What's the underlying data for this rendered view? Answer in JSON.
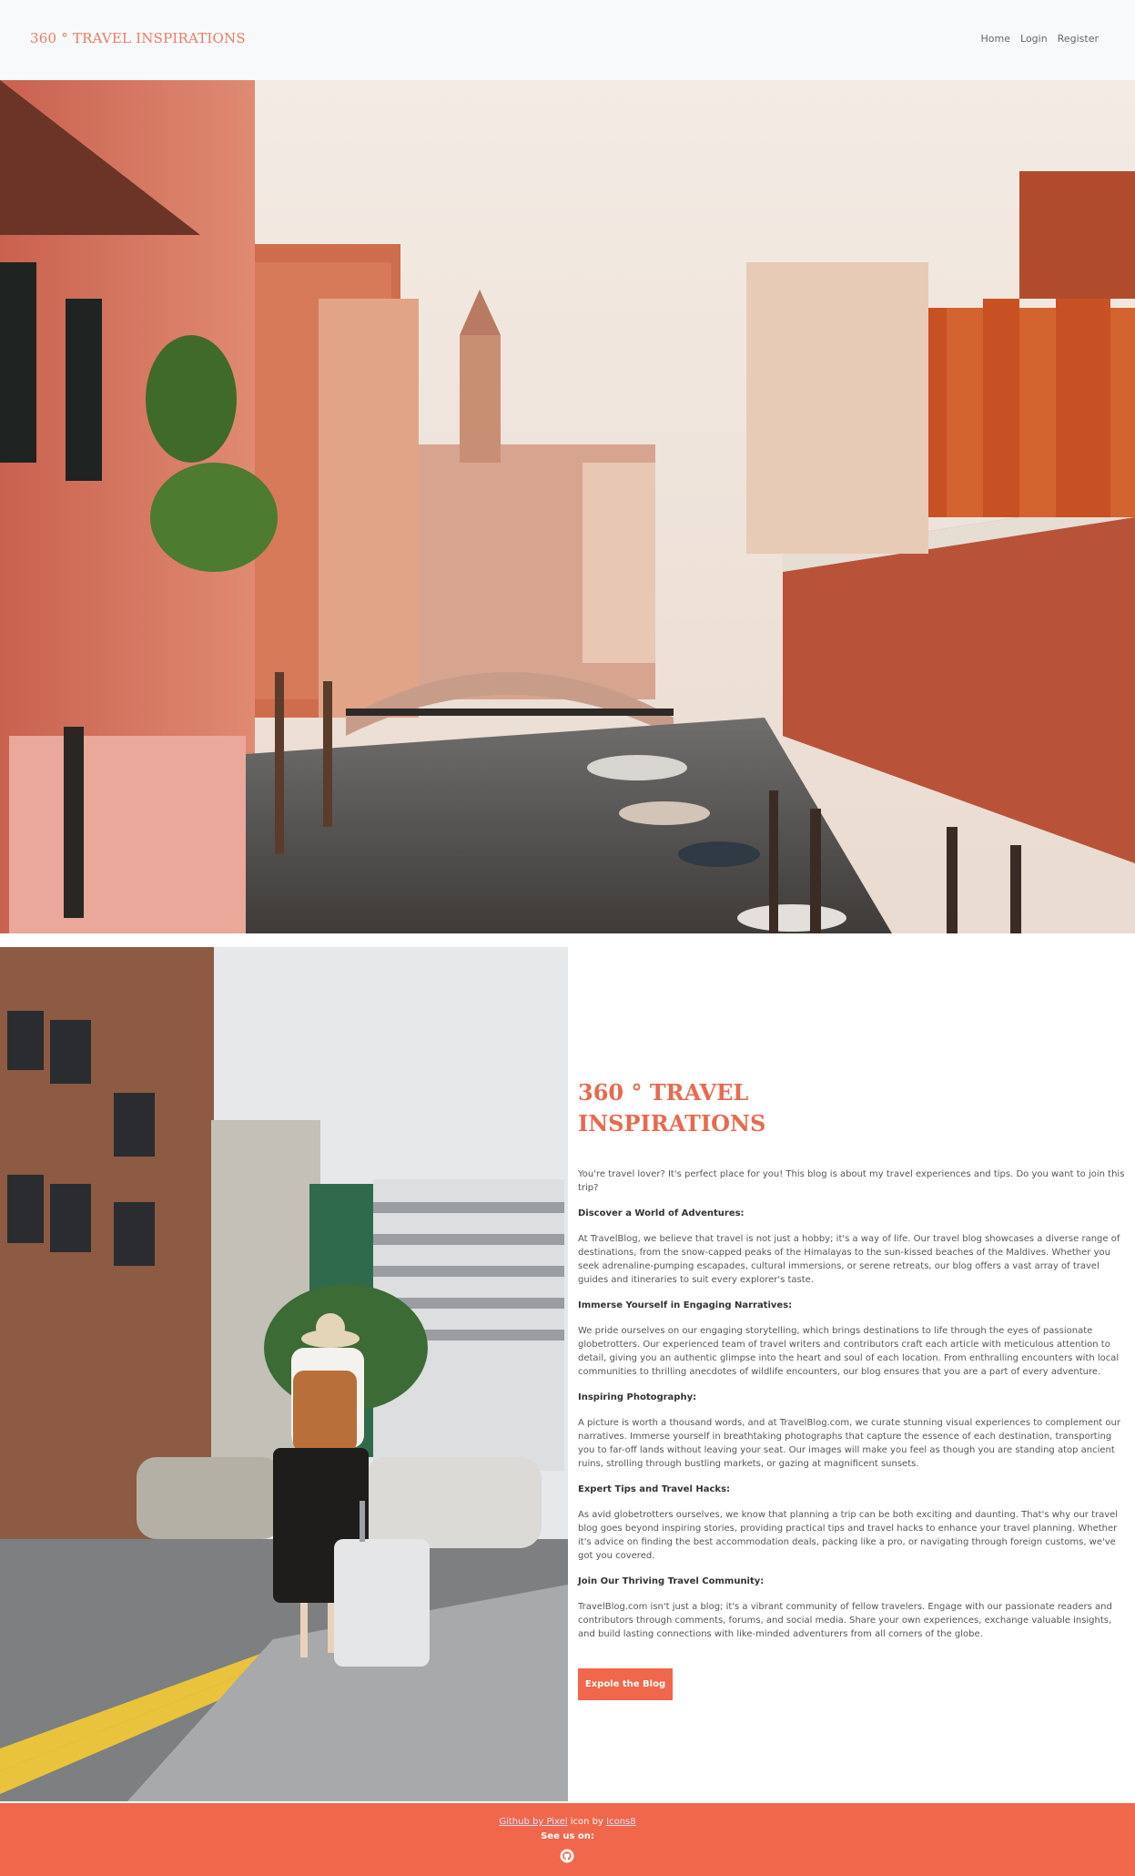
{
  "brand": "360 ° TRAVEL INSPIRATIONS",
  "nav": {
    "home": "Home",
    "login": "Login",
    "register": "Register"
  },
  "hero": {
    "image": "venice-canal-photo"
  },
  "side": {
    "image": "traveler-with-suitcase-photo"
  },
  "main": {
    "title": "360 ° TRAVEL INSPIRATIONS",
    "intro": "You're travel lover? It's perfect place for you! This blog is about my travel experiences and tips. Do you want to join this trip?",
    "sections": [
      {
        "heading": "Discover a World of Adventures:",
        "text": "At TravelBlog, we believe that travel is not just a hobby; it's a way of life. Our travel blog showcases a diverse range of destinations, from the snow-capped peaks of the Himalayas to the sun-kissed beaches of the Maldives. Whether you seek adrenaline-pumping escapades, cultural immersions, or serene retreats, our blog offers a vast array of travel guides and itineraries to suit every explorer's taste."
      },
      {
        "heading": "Immerse Yourself in Engaging Narratives:",
        "text": "We pride ourselves on our engaging storytelling, which brings destinations to life through the eyes of passionate globetrotters. Our experienced team of travel writers and contributors craft each article with meticulous attention to detail, giving you an authentic glimpse into the heart and soul of each location. From enthralling encounters with local communities to thrilling anecdotes of wildlife encounters, our blog ensures that you are a part of every adventure."
      },
      {
        "heading": "Inspiring Photography:",
        "text": "A picture is worth a thousand words, and at TravelBlog.com, we curate stunning visual experiences to complement our narratives. Immerse yourself in breathtaking photographs that capture the essence of each destination, transporting you to far-off lands without leaving your seat. Our images will make you feel as though you are standing atop ancient ruins, strolling through bustling markets, or gazing at magnificent sunsets."
      },
      {
        "heading": "Expert Tips and Travel Hacks:",
        "text": "As avid globetrotters ourselves, we know that planning a trip can be both exciting and daunting. That's why our travel blog goes beyond inspiring stories, providing practical tips and travel hacks to enhance your travel planning. Whether it's advice on finding the best accommodation deals, packing like a pro, or navigating through foreign customs, we've got you covered."
      },
      {
        "heading": "Join Our Thriving Travel Community:",
        "text": "TravelBlog.com isn't just a blog; it's a vibrant community of fellow travelers. Engage with our passionate readers and contributors through comments, forums, and social media. Share your own experiences, exchange valuable insights, and build lasting connections with like-minded adventurers from all corners of the globe."
      }
    ],
    "cta": "Expole the Blog"
  },
  "footer": {
    "link1": "Github by Pixel",
    "mid": " icon by ",
    "link2": "Icons8",
    "see": "See us on:",
    "icon": "github-icon"
  },
  "colors": {
    "accent": "#f0674b",
    "brand": "#f07a5f",
    "header_bg": "#f8f9fb"
  }
}
